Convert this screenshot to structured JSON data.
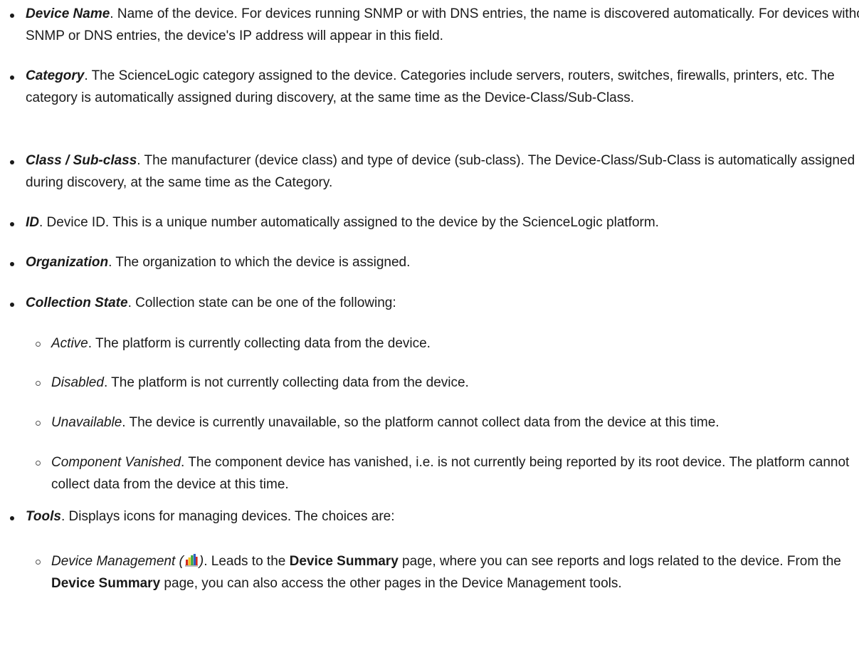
{
  "items": [
    {
      "term": "Device Name",
      "text": ". Name of the device. For devices running SNMP or with DNS entries, the name is discovered automatically. For devices without SNMP or DNS entries, the device's IP address will appear in this field."
    },
    {
      "term": "Category",
      "text": ". The ScienceLogic category assigned to the device. Categories include servers, routers, switches, firewalls, printers, etc. The category is automatically assigned during discovery, at the same time as the Device-Class/Sub-Class."
    },
    {
      "term": "Class / Sub-class",
      "text": ". The manufacturer (device class) and type of device (sub-class). The Device-Class/Sub-Class is automatically assigned during discovery, at the same time as the Category."
    },
    {
      "term": "ID",
      "text": ". Device ID. This is a unique number automatically assigned to the device by the ScienceLogic platform."
    },
    {
      "term": "Organization",
      "text": ". The organization to which the device is assigned."
    },
    {
      "term": "Collection State",
      "text": ". Collection state can be one of the following:"
    }
  ],
  "collection_states": [
    {
      "term": "Active",
      "text": ". The platform is currently collecting data from the device."
    },
    {
      "term": "Disabled",
      "text": ". The platform is not currently collecting data from the device."
    },
    {
      "term": "Unavailable",
      "text": ". The device is currently unavailable, so the platform cannot collect data from the device at this time."
    },
    {
      "term": "Component Vanished",
      "text": ". The component device has vanished, i.e. is not currently being reported by its root device. The platform cannot collect data from the device at this time."
    }
  ],
  "tools": {
    "term": "Tools",
    "text": ". Displays icons for managing devices. The choices are:",
    "device_management": {
      "term_open": "Device Management (",
      "icon": "device-management-bar-chart-icon",
      "term_close": ")",
      "text_1": ". Leads to the ",
      "bold_1": "Device Summary",
      "text_2": " page, where you can see reports and logs related to the device. From the ",
      "bold_2": "Device Summary",
      "text_3": " page, you can also access the other pages in the Device Management tools."
    }
  },
  "colors": {
    "text": "#1a1a1a",
    "icon_red": "#d42a1e",
    "icon_yellow": "#f2c21b",
    "icon_green": "#3aa63a",
    "icon_blue": "#2f5fc4"
  }
}
